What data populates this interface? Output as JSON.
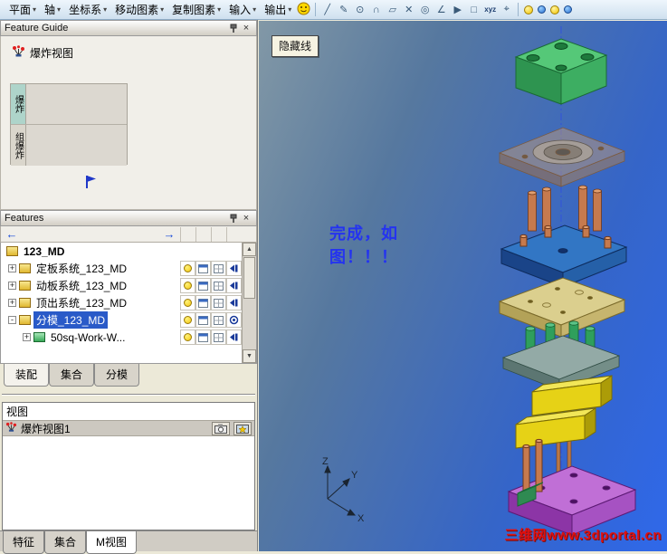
{
  "toolbar": {
    "caret": "▾",
    "menus": [
      "平面",
      "轴",
      "坐标系",
      "移动图素",
      "复制图素",
      "输入",
      "输出"
    ],
    "icons": [
      {
        "name": "line-tool-icon",
        "glyph": "╱"
      },
      {
        "name": "pencil-tool-icon",
        "glyph": "✎"
      },
      {
        "name": "circle-tool-icon",
        "glyph": "⊙"
      },
      {
        "name": "arc-tool-icon",
        "glyph": "∩"
      },
      {
        "name": "plane-tool-icon",
        "glyph": "▱"
      },
      {
        "name": "erase-tool-icon",
        "glyph": "✕"
      },
      {
        "name": "zoom-tool-icon",
        "glyph": "◎"
      },
      {
        "name": "polyline-tool-icon",
        "glyph": "∠"
      },
      {
        "name": "select-tool-icon",
        "glyph": "▶"
      },
      {
        "name": "grid-tool-icon",
        "glyph": "□"
      },
      {
        "name": "xyz-axis-icon",
        "glyph": "xyz"
      },
      {
        "name": "target-tool-icon",
        "glyph": "⌖"
      }
    ]
  },
  "feature_guide": {
    "title": "Feature Guide",
    "tool_label": "爆炸视图",
    "buttons": [
      {
        "label": "爆炸"
      },
      {
        "label": "组爆炸"
      }
    ]
  },
  "features": {
    "title": "Features",
    "tree": [
      {
        "label": "123_MD",
        "expand": ""
      },
      {
        "label": "定板系统_123_MD",
        "expand": "+"
      },
      {
        "label": "动板系统_123_MD",
        "expand": "+"
      },
      {
        "label": "顶出系统_123_MD",
        "expand": "+"
      },
      {
        "label": "分模_123_MD",
        "expand": "-"
      },
      {
        "label": "50sq-Work-W...",
        "expand": "+"
      }
    ],
    "tabs": [
      {
        "label": "装配"
      },
      {
        "label": "集合"
      },
      {
        "label": "分模"
      }
    ]
  },
  "views_panel": {
    "title": "视图",
    "items": [
      {
        "label": "爆炸视图1"
      }
    ]
  },
  "bottom_tabs": [
    {
      "label": "特征"
    },
    {
      "label": "集合"
    },
    {
      "label": "M视图"
    }
  ],
  "viewport": {
    "hidden_line_button": "隐藏线",
    "annotation": [
      "完成，如",
      "图！！！"
    ],
    "watermark": "三维网www.3dportal.cn",
    "axes": {
      "x": "X",
      "y": "Y",
      "z": "Z"
    }
  },
  "colors": {
    "selection_blue": "#2a5ac8",
    "annotation_blue": "#2433f0",
    "watermark_red": "#e01010",
    "viewport_gradient_top": "#8298a6",
    "viewport_gradient_bottom": "#2f68ea"
  },
  "model_parts": [
    {
      "name": "top-clamp-plate",
      "color": "#55c878"
    },
    {
      "name": "cavity-insert-plate",
      "color": "#c09a78"
    },
    {
      "name": "guide-pins",
      "color": "#c67a4e"
    },
    {
      "name": "a-plate",
      "color": "#3276c4"
    },
    {
      "name": "b-plate",
      "color": "#dbcf8e"
    },
    {
      "name": "support-plate",
      "color": "#93aaa6"
    },
    {
      "name": "spacer-blocks",
      "color": "#e6d216"
    },
    {
      "name": "bottom-clamp-plate",
      "color": "#c06fd6"
    }
  ]
}
